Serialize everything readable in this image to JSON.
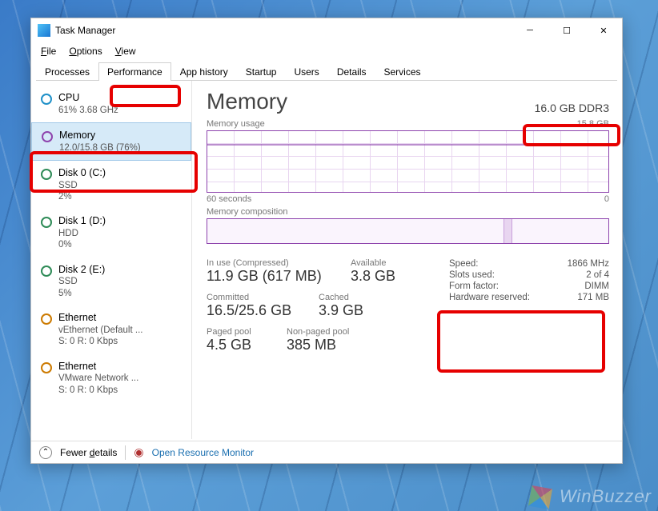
{
  "window": {
    "title": "Task Manager"
  },
  "menu": [
    "File",
    "Options",
    "View"
  ],
  "tabs": [
    "Processes",
    "Performance",
    "App history",
    "Startup",
    "Users",
    "Details",
    "Services"
  ],
  "active_tab": "Performance",
  "sidebar": [
    {
      "title": "CPU",
      "sub": "61% 3.68 GHz",
      "color": "#1e90c8"
    },
    {
      "title": "Memory",
      "sub": "12.0/15.8 GB (76%)",
      "color": "#8e44ad",
      "selected": true
    },
    {
      "title": "Disk 0 (C:)",
      "sub": "SSD\n2%",
      "color": "#2e8b57"
    },
    {
      "title": "Disk 1 (D:)",
      "sub": "HDD\n0%",
      "color": "#2e8b57"
    },
    {
      "title": "Disk 2 (E:)",
      "sub": "SSD\n5%",
      "color": "#2e8b57"
    },
    {
      "title": "Ethernet",
      "sub": "vEthernet (Default ...\nS: 0 R: 0 Kbps",
      "color": "#cc7a00"
    },
    {
      "title": "Ethernet",
      "sub": "VMware Network ...\nS: 0 R: 0 Kbps",
      "color": "#cc7a00"
    }
  ],
  "main": {
    "title": "Memory",
    "spec": "16.0 GB DDR3",
    "usage_label": "Memory usage",
    "usage_max": "15.8 GB",
    "x_start": "60 seconds",
    "x_end": "0",
    "comp_label": "Memory composition",
    "stats": {
      "in_use_label": "In use (Compressed)",
      "in_use": "11.9 GB (617 MB)",
      "available_label": "Available",
      "available": "3.8 GB",
      "committed_label": "Committed",
      "committed": "16.5/25.6 GB",
      "cached_label": "Cached",
      "cached": "3.9 GB",
      "paged_label": "Paged pool",
      "paged": "4.5 GB",
      "nonpaged_label": "Non-paged pool",
      "nonpaged": "385 MB"
    },
    "details": [
      {
        "k": "Speed:",
        "v": "1866 MHz"
      },
      {
        "k": "Slots used:",
        "v": "2 of 4"
      },
      {
        "k": "Form factor:",
        "v": "DIMM"
      },
      {
        "k": "Hardware reserved:",
        "v": "171 MB"
      }
    ]
  },
  "bottom": {
    "fewer": "Fewer details",
    "resmon": "Open Resource Monitor"
  },
  "watermark": "WinBuzzer",
  "chart_data": {
    "type": "line",
    "title": "Memory usage",
    "xlabel": "seconds",
    "ylabel": "GB",
    "xlim": [
      60,
      0
    ],
    "ylim": [
      0,
      15.8
    ],
    "series": [
      {
        "name": "Memory usage",
        "approx_value": 12.0,
        "note": "roughly flat ~12 GB over 60s"
      }
    ]
  }
}
